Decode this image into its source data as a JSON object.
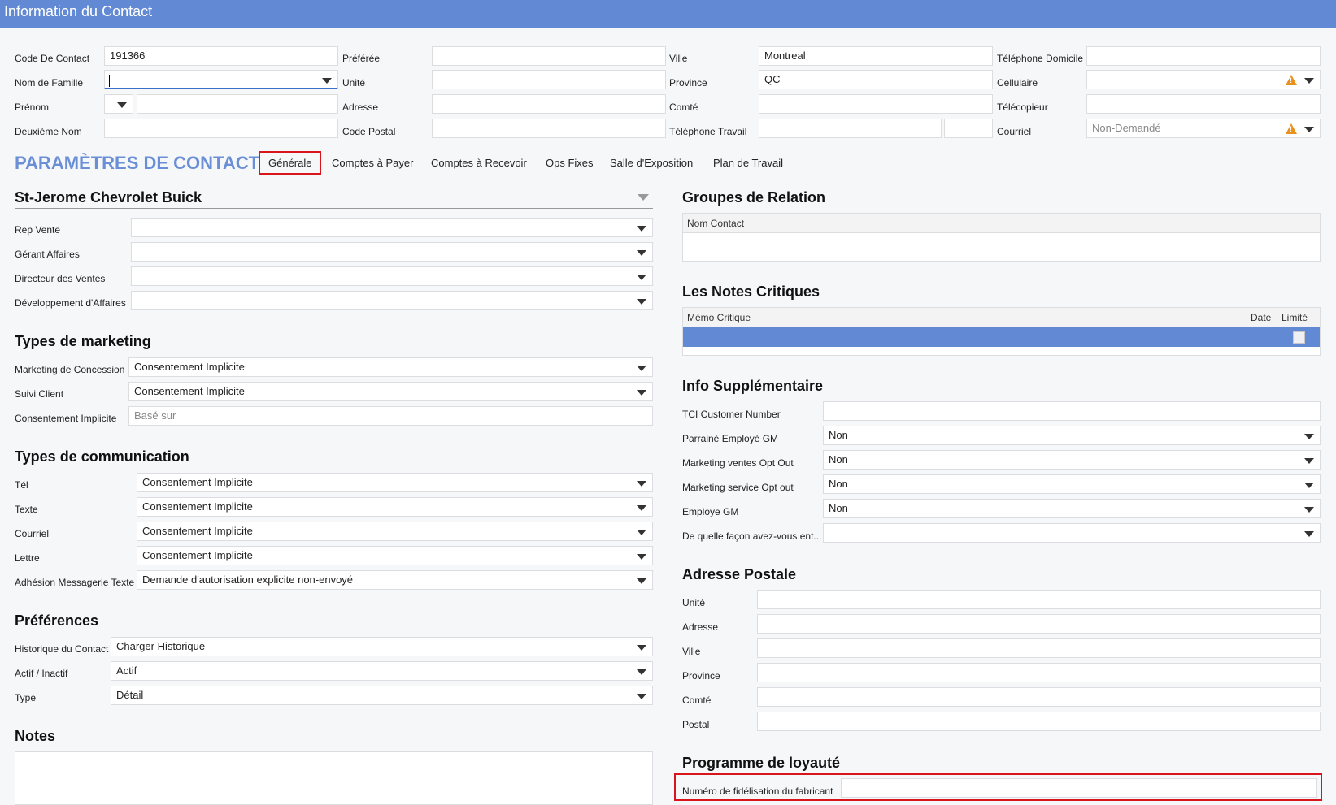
{
  "window": {
    "title": "Information du Contact"
  },
  "header_fields": {
    "code_contact": {
      "label": "Code De Contact",
      "value": "191366"
    },
    "nom_famille": {
      "label": "Nom de Famille",
      "value": ""
    },
    "prenom": {
      "label": "Prénom",
      "value": ""
    },
    "deuxieme_nom": {
      "label": "Deuxième Nom",
      "value": ""
    },
    "preferee": {
      "label": "Préférée",
      "value": ""
    },
    "unite": {
      "label": "Unité",
      "value": ""
    },
    "adresse": {
      "label": "Adresse",
      "value": ""
    },
    "code_postal": {
      "label": "Code Postal",
      "value": ""
    },
    "ville": {
      "label": "Ville",
      "value": "Montreal"
    },
    "province": {
      "label": "Province",
      "value": "QC"
    },
    "comte": {
      "label": "Comté",
      "value": ""
    },
    "telephone_travail": {
      "label": "Téléphone Travail",
      "value": ""
    },
    "telephone_domicile": {
      "label": "Téléphone Domicile",
      "value": ""
    },
    "cellulaire": {
      "label": "Cellulaire",
      "value": ""
    },
    "telecopieur": {
      "label": "Télécopieur",
      "value": ""
    },
    "courriel": {
      "label": "Courriel",
      "placeholder": "Non-Demandé"
    }
  },
  "settings": {
    "title": "PARAMÈTRES DE CONTACT",
    "tabs": [
      "Générale",
      "Comptes à Payer",
      "Comptes à Recevoir",
      "Ops Fixes",
      "Salle d'Exposition",
      "Plan de Travail"
    ]
  },
  "dealer": {
    "title": "St-Jerome Chevrolet Buick",
    "fields": [
      {
        "label": "Rep Vente",
        "value": ""
      },
      {
        "label": "Gérant Affaires",
        "value": ""
      },
      {
        "label": "Directeur des Ventes",
        "value": ""
      },
      {
        "label": "Développement d'Affaires",
        "value": ""
      }
    ]
  },
  "marketing": {
    "title": "Types de marketing",
    "fields": [
      {
        "label": "Marketing de Concession",
        "value": "Consentement Implicite"
      },
      {
        "label": "Suivi Client",
        "value": "Consentement Implicite"
      },
      {
        "label": "Consentement Implicite",
        "placeholder": "Basé sur"
      }
    ]
  },
  "communication": {
    "title": "Types de communication",
    "fields": [
      {
        "label": "Tél",
        "value": "Consentement Implicite"
      },
      {
        "label": "Texte",
        "value": "Consentement Implicite"
      },
      {
        "label": "Courriel",
        "value": "Consentement Implicite"
      },
      {
        "label": "Lettre",
        "value": "Consentement Implicite"
      },
      {
        "label": "Adhésion Messagerie Texte",
        "value": "Demande d'autorisation explicite non-envoyé"
      }
    ]
  },
  "preferences": {
    "title": "Préférences",
    "fields": [
      {
        "label": "Historique du Contact",
        "value": "Charger Historique"
      },
      {
        "label": "Actif / Inactif",
        "value": "Actif"
      },
      {
        "label": "Type",
        "value": "Détail"
      }
    ]
  },
  "notes": {
    "title": "Notes"
  },
  "relation_groups": {
    "title": "Groupes de Relation",
    "columns": [
      "Nom Contact"
    ]
  },
  "critical_notes": {
    "title": "Les Notes Critiques",
    "columns": [
      "Mémo Critique",
      "Date",
      "Limité"
    ]
  },
  "extra_info": {
    "title": "Info Supplémentaire",
    "fields": [
      {
        "label": "TCI Customer Number",
        "value": ""
      },
      {
        "label": "Parrainé Employé GM",
        "value": "Non"
      },
      {
        "label": "Marketing ventes Opt Out",
        "value": "Non"
      },
      {
        "label": "Marketing service Opt out",
        "value": "Non"
      },
      {
        "label": "Employe GM",
        "value": "Non"
      },
      {
        "label": "De quelle façon avez-vous ent...",
        "value": ""
      }
    ]
  },
  "postal_address": {
    "title": "Adresse Postale",
    "fields": [
      {
        "label": "Unité",
        "value": ""
      },
      {
        "label": "Adresse",
        "value": ""
      },
      {
        "label": "Ville",
        "value": ""
      },
      {
        "label": "Province",
        "value": ""
      },
      {
        "label": "Comté",
        "value": ""
      },
      {
        "label": "Postal",
        "value": ""
      }
    ]
  },
  "loyalty": {
    "title": "Programme de loyauté",
    "fields": [
      {
        "label": "Numéro de fidélisation du fabricant",
        "value": ""
      }
    ]
  },
  "colors": {
    "header": "#6289d4",
    "accent": "#6a8fd6",
    "highlight": "#d9141b",
    "warning": "#e8911c"
  },
  "icons": [
    "chevron-down-icon",
    "warning-icon",
    "checkbox-icon"
  ]
}
